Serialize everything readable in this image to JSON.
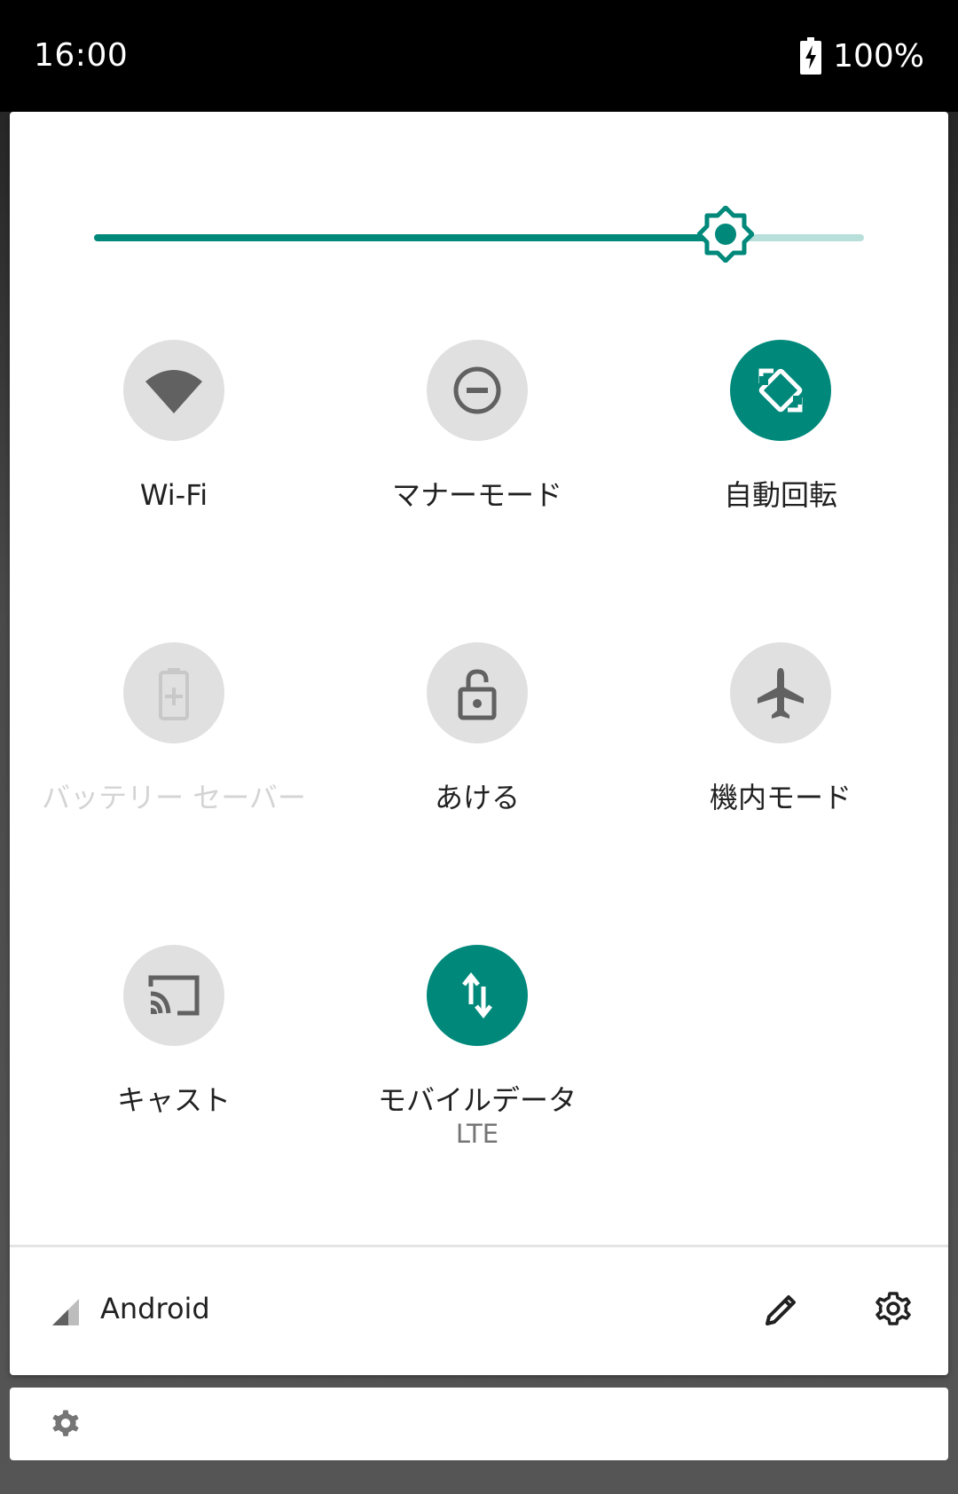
{
  "status_bar": {
    "time": "16:00",
    "battery_percent": "100%",
    "battery_icon": "battery-charging-icon"
  },
  "brightness": {
    "level_fraction": 0.82,
    "accent_color": "#00897b",
    "track_color": "#b9dfda"
  },
  "tiles": [
    {
      "label": "Wi-Fi",
      "icon": "wifi-icon",
      "state": "inactive"
    },
    {
      "label": "マナーモード",
      "icon": "do-not-disturb-icon",
      "state": "inactive"
    },
    {
      "label": "自動回転",
      "icon": "auto-rotate-icon",
      "state": "active"
    },
    {
      "label": "バッテリー セーバー",
      "icon": "battery-saver-icon",
      "state": "disabled"
    },
    {
      "label": "あける",
      "icon": "unlock-icon",
      "state": "inactive"
    },
    {
      "label": "機内モード",
      "icon": "airplane-icon",
      "state": "inactive"
    },
    {
      "label": "キャスト",
      "icon": "cast-icon",
      "state": "inactive"
    },
    {
      "label": "モバイルデータ",
      "sublabel": "LTE",
      "icon": "mobile-data-icon",
      "state": "active"
    }
  ],
  "footer": {
    "carrier": "Android",
    "signal_icon": "cell-signal-icon",
    "edit_icon": "edit-pencil-icon",
    "settings_icon": "settings-gear-icon"
  },
  "notification": {
    "icon": "settings-gear-icon"
  }
}
